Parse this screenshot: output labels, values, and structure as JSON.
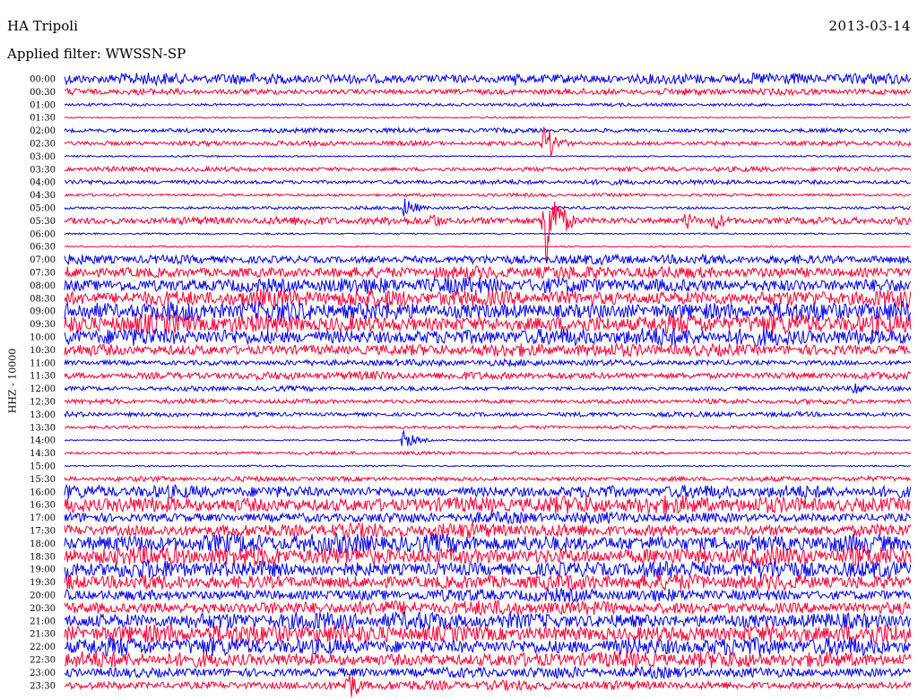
{
  "header": {
    "station": "HA Tripoli",
    "date": "2013-03-14",
    "filter": "Applied filter: WWSSN-SP",
    "channel": "HHZ - 10000"
  },
  "colors": {
    "odd": "#0000ee",
    "even": "#ff0033",
    "trace_colors": [
      "#0000ee",
      "#ff0033"
    ]
  },
  "chart_data": {
    "type": "line",
    "title": "",
    "xlabel": "",
    "ylabel": "HHZ - 10000",
    "rows": [
      {
        "label": "00:00",
        "amp": 7
      },
      {
        "label": "00:30",
        "amp": 4
      },
      {
        "label": "01:00",
        "amp": 2
      },
      {
        "label": "01:30",
        "amp": 1
      },
      {
        "label": "02:00",
        "amp": 3
      },
      {
        "label": "02:30",
        "amp": 3
      },
      {
        "label": "03:00",
        "amp": 1
      },
      {
        "label": "03:30",
        "amp": 3
      },
      {
        "label": "04:00",
        "amp": 3
      },
      {
        "label": "04:30",
        "amp": 2
      },
      {
        "label": "05:00",
        "amp": 2
      },
      {
        "label": "05:30",
        "amp": 5
      },
      {
        "label": "06:00",
        "amp": 1
      },
      {
        "label": "06:30",
        "amp": 1
      },
      {
        "label": "07:00",
        "amp": 6
      },
      {
        "label": "07:30",
        "amp": 8
      },
      {
        "label": "08:00",
        "amp": 10
      },
      {
        "label": "08:30",
        "amp": 11
      },
      {
        "label": "09:00",
        "amp": 12
      },
      {
        "label": "09:30",
        "amp": 12
      },
      {
        "label": "10:00",
        "amp": 11
      },
      {
        "label": "10:30",
        "amp": 8
      },
      {
        "label": "11:00",
        "amp": 4
      },
      {
        "label": "11:30",
        "amp": 5
      },
      {
        "label": "12:00",
        "amp": 3
      },
      {
        "label": "12:30",
        "amp": 3
      },
      {
        "label": "13:00",
        "amp": 3
      },
      {
        "label": "13:30",
        "amp": 2
      },
      {
        "label": "14:00",
        "amp": 1
      },
      {
        "label": "14:30",
        "amp": 2
      },
      {
        "label": "15:00",
        "amp": 1
      },
      {
        "label": "15:30",
        "amp": 3
      },
      {
        "label": "16:00",
        "amp": 8
      },
      {
        "label": "16:30",
        "amp": 11
      },
      {
        "label": "17:00",
        "amp": 7
      },
      {
        "label": "17:30",
        "amp": 9
      },
      {
        "label": "18:00",
        "amp": 12
      },
      {
        "label": "18:30",
        "amp": 12
      },
      {
        "label": "19:00",
        "amp": 11
      },
      {
        "label": "19:30",
        "amp": 10
      },
      {
        "label": "20:00",
        "amp": 8
      },
      {
        "label": "20:30",
        "amp": 9
      },
      {
        "label": "21:00",
        "amp": 11
      },
      {
        "label": "21:30",
        "amp": 12
      },
      {
        "label": "22:00",
        "amp": 11
      },
      {
        "label": "22:30",
        "amp": 10
      },
      {
        "label": "23:00",
        "amp": 7
      },
      {
        "label": "23:30",
        "amp": 6
      }
    ],
    "events": [
      {
        "row": 11,
        "minute": 13,
        "amp": 12
      },
      {
        "row": 11,
        "minute": 23,
        "amp": 14
      },
      {
        "row": 10,
        "minute": 12,
        "amp": 14
      },
      {
        "row": 5,
        "minute": 17,
        "amp": 24
      },
      {
        "row": 11,
        "minute": 17,
        "amp": 70
      },
      {
        "row": 11,
        "minute": 22,
        "amp": 12
      },
      {
        "row": 28,
        "minute": 12,
        "amp": 12
      },
      {
        "row": 47,
        "minute": 10,
        "amp": 22
      },
      {
        "row": 24,
        "minute": 28,
        "amp": 10
      },
      {
        "row": 0,
        "minute": 16,
        "amp": 10
      }
    ]
  }
}
